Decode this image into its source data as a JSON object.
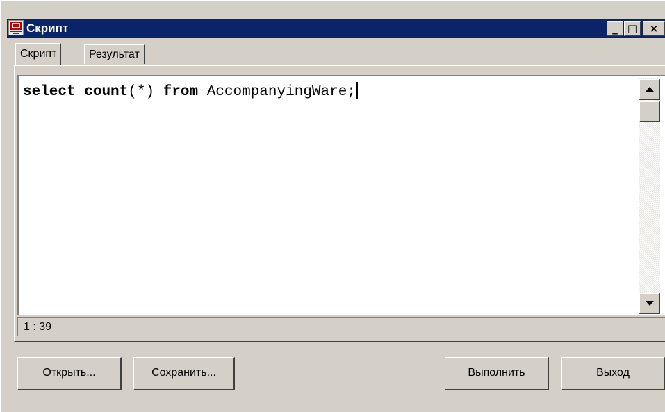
{
  "window": {
    "title": "Скрипт",
    "icon": "script-app-icon",
    "controls": {
      "minimize": "_",
      "maximize": "□",
      "close": "×"
    }
  },
  "tabs": [
    {
      "label": "Скрипт",
      "active": true
    },
    {
      "label": "Результат",
      "active": false
    }
  ],
  "editor": {
    "tokens": [
      "select",
      " ",
      "count",
      "(*) ",
      "from",
      " AccompanyingWare;"
    ],
    "cursor": "1 : 39"
  },
  "buttons": {
    "open": "Открыть...",
    "save": "Сохранить...",
    "run": "Выполнить",
    "exit": "Выход"
  },
  "colors": {
    "titlebar": "#0a246a",
    "face": "#d4d0c8",
    "editor_bg": "#ffffff"
  }
}
